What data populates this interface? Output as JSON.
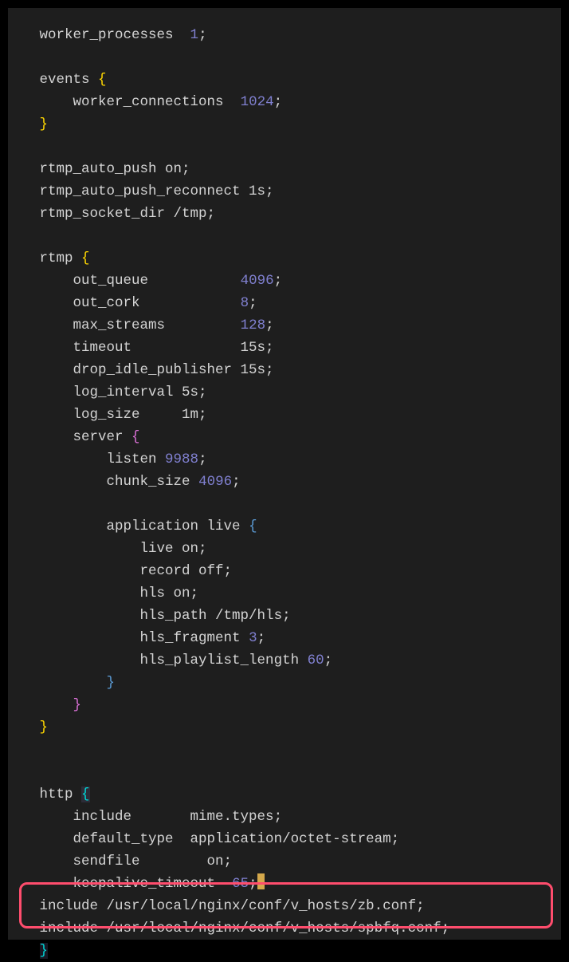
{
  "code": {
    "line1_a": "worker_processes  ",
    "line1_b": "1",
    "line1_c": ";",
    "line3_a": "events ",
    "line4_a": "    worker_connections  ",
    "line4_b": "1024",
    "line4_c": ";",
    "line7_a": "rtmp_auto_push on;",
    "line8_a": "rtmp_auto_push_reconnect 1s;",
    "line9_a": "rtmp_socket_dir /tmp;",
    "line11_a": "rtmp ",
    "line12_a": "    out_queue           ",
    "line12_b": "4096",
    "line12_c": ";",
    "line13_a": "    out_cork            ",
    "line13_b": "8",
    "line13_c": ";",
    "line14_a": "    max_streams         ",
    "line14_b": "128",
    "line14_c": ";",
    "line15_a": "    timeout             15s;",
    "line16_a": "    drop_idle_publisher 15s;",
    "line17_a": "    log_interval 5s;",
    "line18_a": "    log_size     1m;",
    "line19_a": "    server ",
    "line20_a": "        listen ",
    "line20_b": "9988",
    "line20_c": ";",
    "line21_a": "        chunk_size ",
    "line21_b": "4096",
    "line21_c": ";",
    "line23_a": "        application live ",
    "line24_a": "            live on;",
    "line25_a": "            record off;",
    "line26_a": "            hls on;",
    "line27_a": "            hls_path /tmp/hls;",
    "line28_a": "            hls_fragment ",
    "line28_b": "3",
    "line28_c": ";",
    "line29_a": "            hls_playlist_length ",
    "line29_b": "60",
    "line29_c": ";",
    "line35_a": "http ",
    "line36_a": "    include       mime.types;",
    "line37_a": "    default_type  application/octet-stream;",
    "line38_a": "    sendfile        on;",
    "line39_a": "    keepalive_timeout  ",
    "line39_b": "65",
    "line39_c": ";",
    "line40_a": "include /usr/local/nginx/conf/v_hosts/zb.conf;",
    "line41_a": "include /usr/local/nginx/conf/v_hosts/spbfq.conf;"
  },
  "braces": {
    "open": "{",
    "close": "}"
  }
}
